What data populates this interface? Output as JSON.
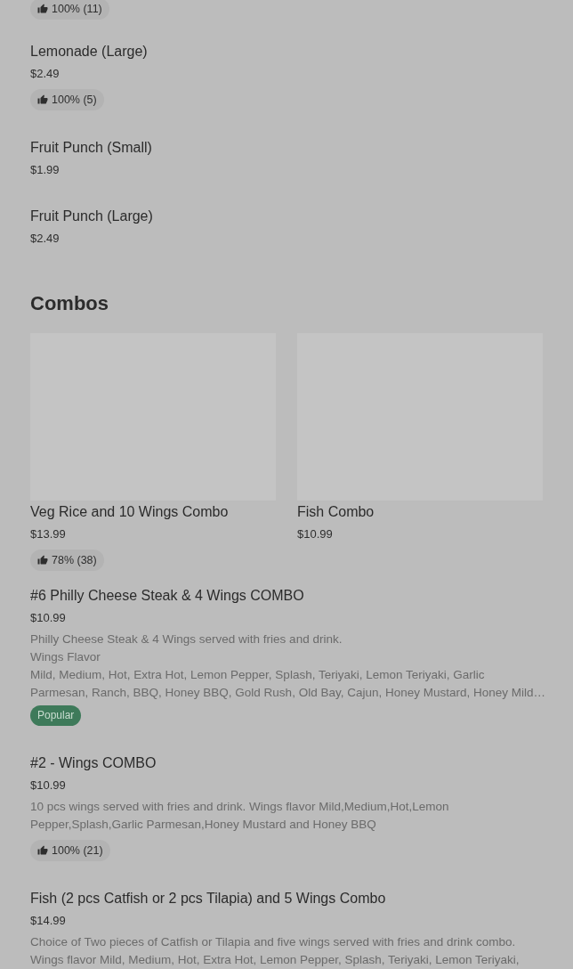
{
  "top_items": [
    {
      "rating": "100% (11)"
    },
    {
      "title": "Lemonade (Large)",
      "price": "$2.49",
      "rating": "100% (5)"
    },
    {
      "title": "Fruit Punch (Small)",
      "price": "$1.99"
    },
    {
      "title": "Fruit Punch (Large)",
      "price": "$2.49"
    }
  ],
  "combos": {
    "heading": "Combos",
    "cards": [
      {
        "title": "Veg Rice and 10 Wings Combo",
        "price": "$13.99",
        "rating": "78% (38)"
      },
      {
        "title": "Fish Combo",
        "price": "$10.99"
      }
    ],
    "items": [
      {
        "title": "#6 Philly Cheese Steak & 4 Wings COMBO",
        "price": "$10.99",
        "description": [
          "Philly Cheese Steak & 4 Wings served with fries and drink.",
          "Wings Flavor",
          "Mild, Medium, Hot, Extra Hot, Lemon Pepper, Splash, Teriyaki, Lemon Teriyaki, Garlic",
          "Parmesan, Ranch, BBQ, Honey BBQ, Gold Rush, Old Bay, Cajun, Honey Mustard, Honey Mild…"
        ],
        "tag": "Popular"
      },
      {
        "title": "#2 - Wings COMBO",
        "price": "$10.99",
        "description": [
          "10 pcs wings served with fries and drink. Wings flavor Mild,Medium,Hot,Lemon",
          "Pepper,Splash,Garlic Parmesan,Honey Mustard and Honey BBQ"
        ],
        "rating": "100% (21)"
      },
      {
        "title": "Fish (2 pcs Catfish or 2 pcs Tilapia) and 5 Wings Combo",
        "price": "$14.99",
        "description": [
          "Choice of Two pieces of Catfish or Tilapia and five wings served with fries and drink combo.",
          "Wings flavor Mild, Medium, Hot, Extra Hot, Lemon Pepper, Splash, Teriyaki, Lemon Teriyaki,"
        ]
      }
    ]
  }
}
